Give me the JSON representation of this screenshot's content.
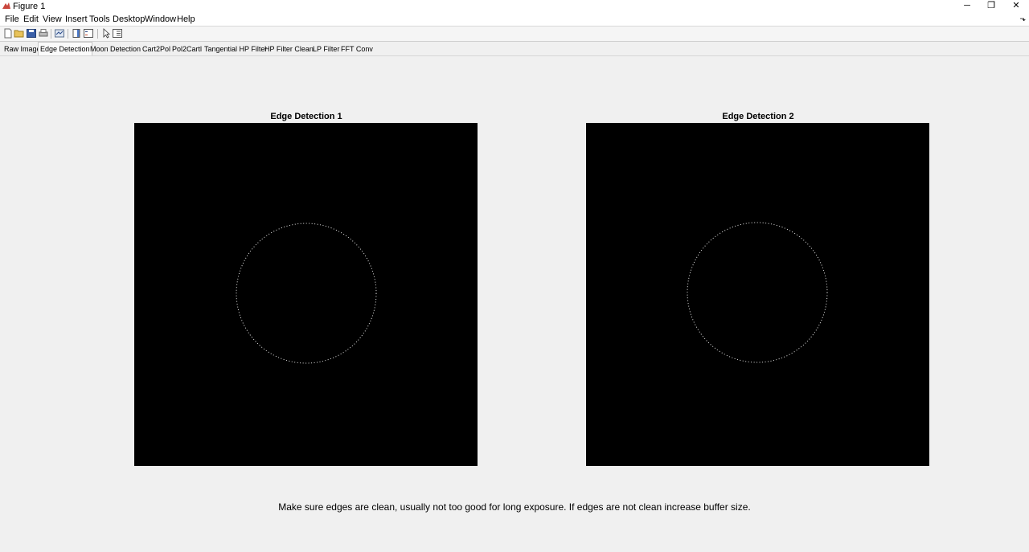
{
  "window": {
    "title": "Figure 1",
    "controls": {
      "minimize": "─",
      "restore": "❐",
      "close": "✕"
    }
  },
  "menu": {
    "items": [
      "File",
      "Edit",
      "View",
      "Insert",
      "Tools",
      "Desktop",
      "Window",
      "Help"
    ],
    "dock_glyph": "⬎"
  },
  "toolbar": {
    "icons": [
      "new-figure-icon",
      "open-file-icon",
      "save-icon",
      "print-icon",
      "link-plot-icon",
      "colorbar-icon",
      "legend-icon",
      "edit-plot-icon",
      "property-inspector-icon"
    ]
  },
  "tabs": {
    "items": [
      "Raw Image",
      "Edge Detection",
      "Moon Detection",
      "Cart2Pol",
      "Pol2Cartl",
      "Tangential HP Filter",
      "HP Filter Clean",
      "LP Filter",
      "FFT Conv"
    ],
    "active": "Edge Detection"
  },
  "plots": [
    {
      "title": "Edge Detection 1"
    },
    {
      "title": "Edge Detection 2"
    }
  ],
  "footnote": "Make sure edges are clean, usually not too good for long exposure. If edges are not clean increase buffer size.",
  "colors": {
    "background": "#f0f0f0",
    "axes_background": "#000000",
    "edge_pixels": "#ffffff",
    "app_icon": "#c9463d"
  }
}
